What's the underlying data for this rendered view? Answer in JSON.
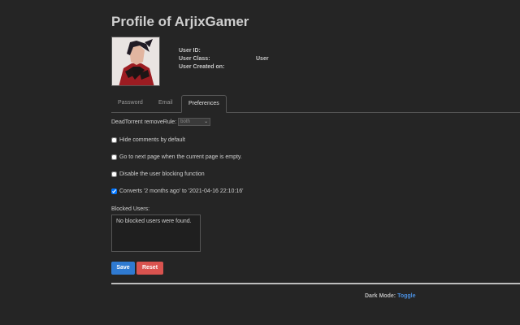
{
  "profile": {
    "title": "Profile of ArjixGamer",
    "avatar_icon": "anime-character-avatar",
    "user_id_label": "User ID:",
    "user_id_value": "",
    "user_class_label": "User Class:",
    "user_class_value": "User",
    "user_created_label": "User Created on:",
    "user_created_value": ""
  },
  "tabs": [
    {
      "label": "Password",
      "active": false
    },
    {
      "label": "Email",
      "active": false
    },
    {
      "label": "Preferences",
      "active": true
    }
  ],
  "preferences": {
    "dead_torrent_label": "DeadTorrent removeRule:",
    "dead_torrent_value": "both",
    "options": [
      {
        "label": "Hide comments by default",
        "checked": false
      },
      {
        "label": "Go to next page when the current page is empty.",
        "checked": false
      },
      {
        "label": "Disable the user blocking function",
        "checked": false
      },
      {
        "label": "Converts '2 months ago' to '2021-04-16 22:10:16'",
        "checked": true
      }
    ]
  },
  "blocked_users": {
    "label": "Blocked Users:",
    "empty_text": "No blocked users were found."
  },
  "buttons": {
    "save": "Save",
    "reset": "Reset"
  },
  "footer": {
    "dark_mode_label": "Dark Mode:",
    "toggle_label": "Toggle"
  },
  "colors": {
    "background": "#252525",
    "save_button": "#2f7ad1",
    "reset_button": "#d9534f",
    "link": "#4a8fe0"
  }
}
